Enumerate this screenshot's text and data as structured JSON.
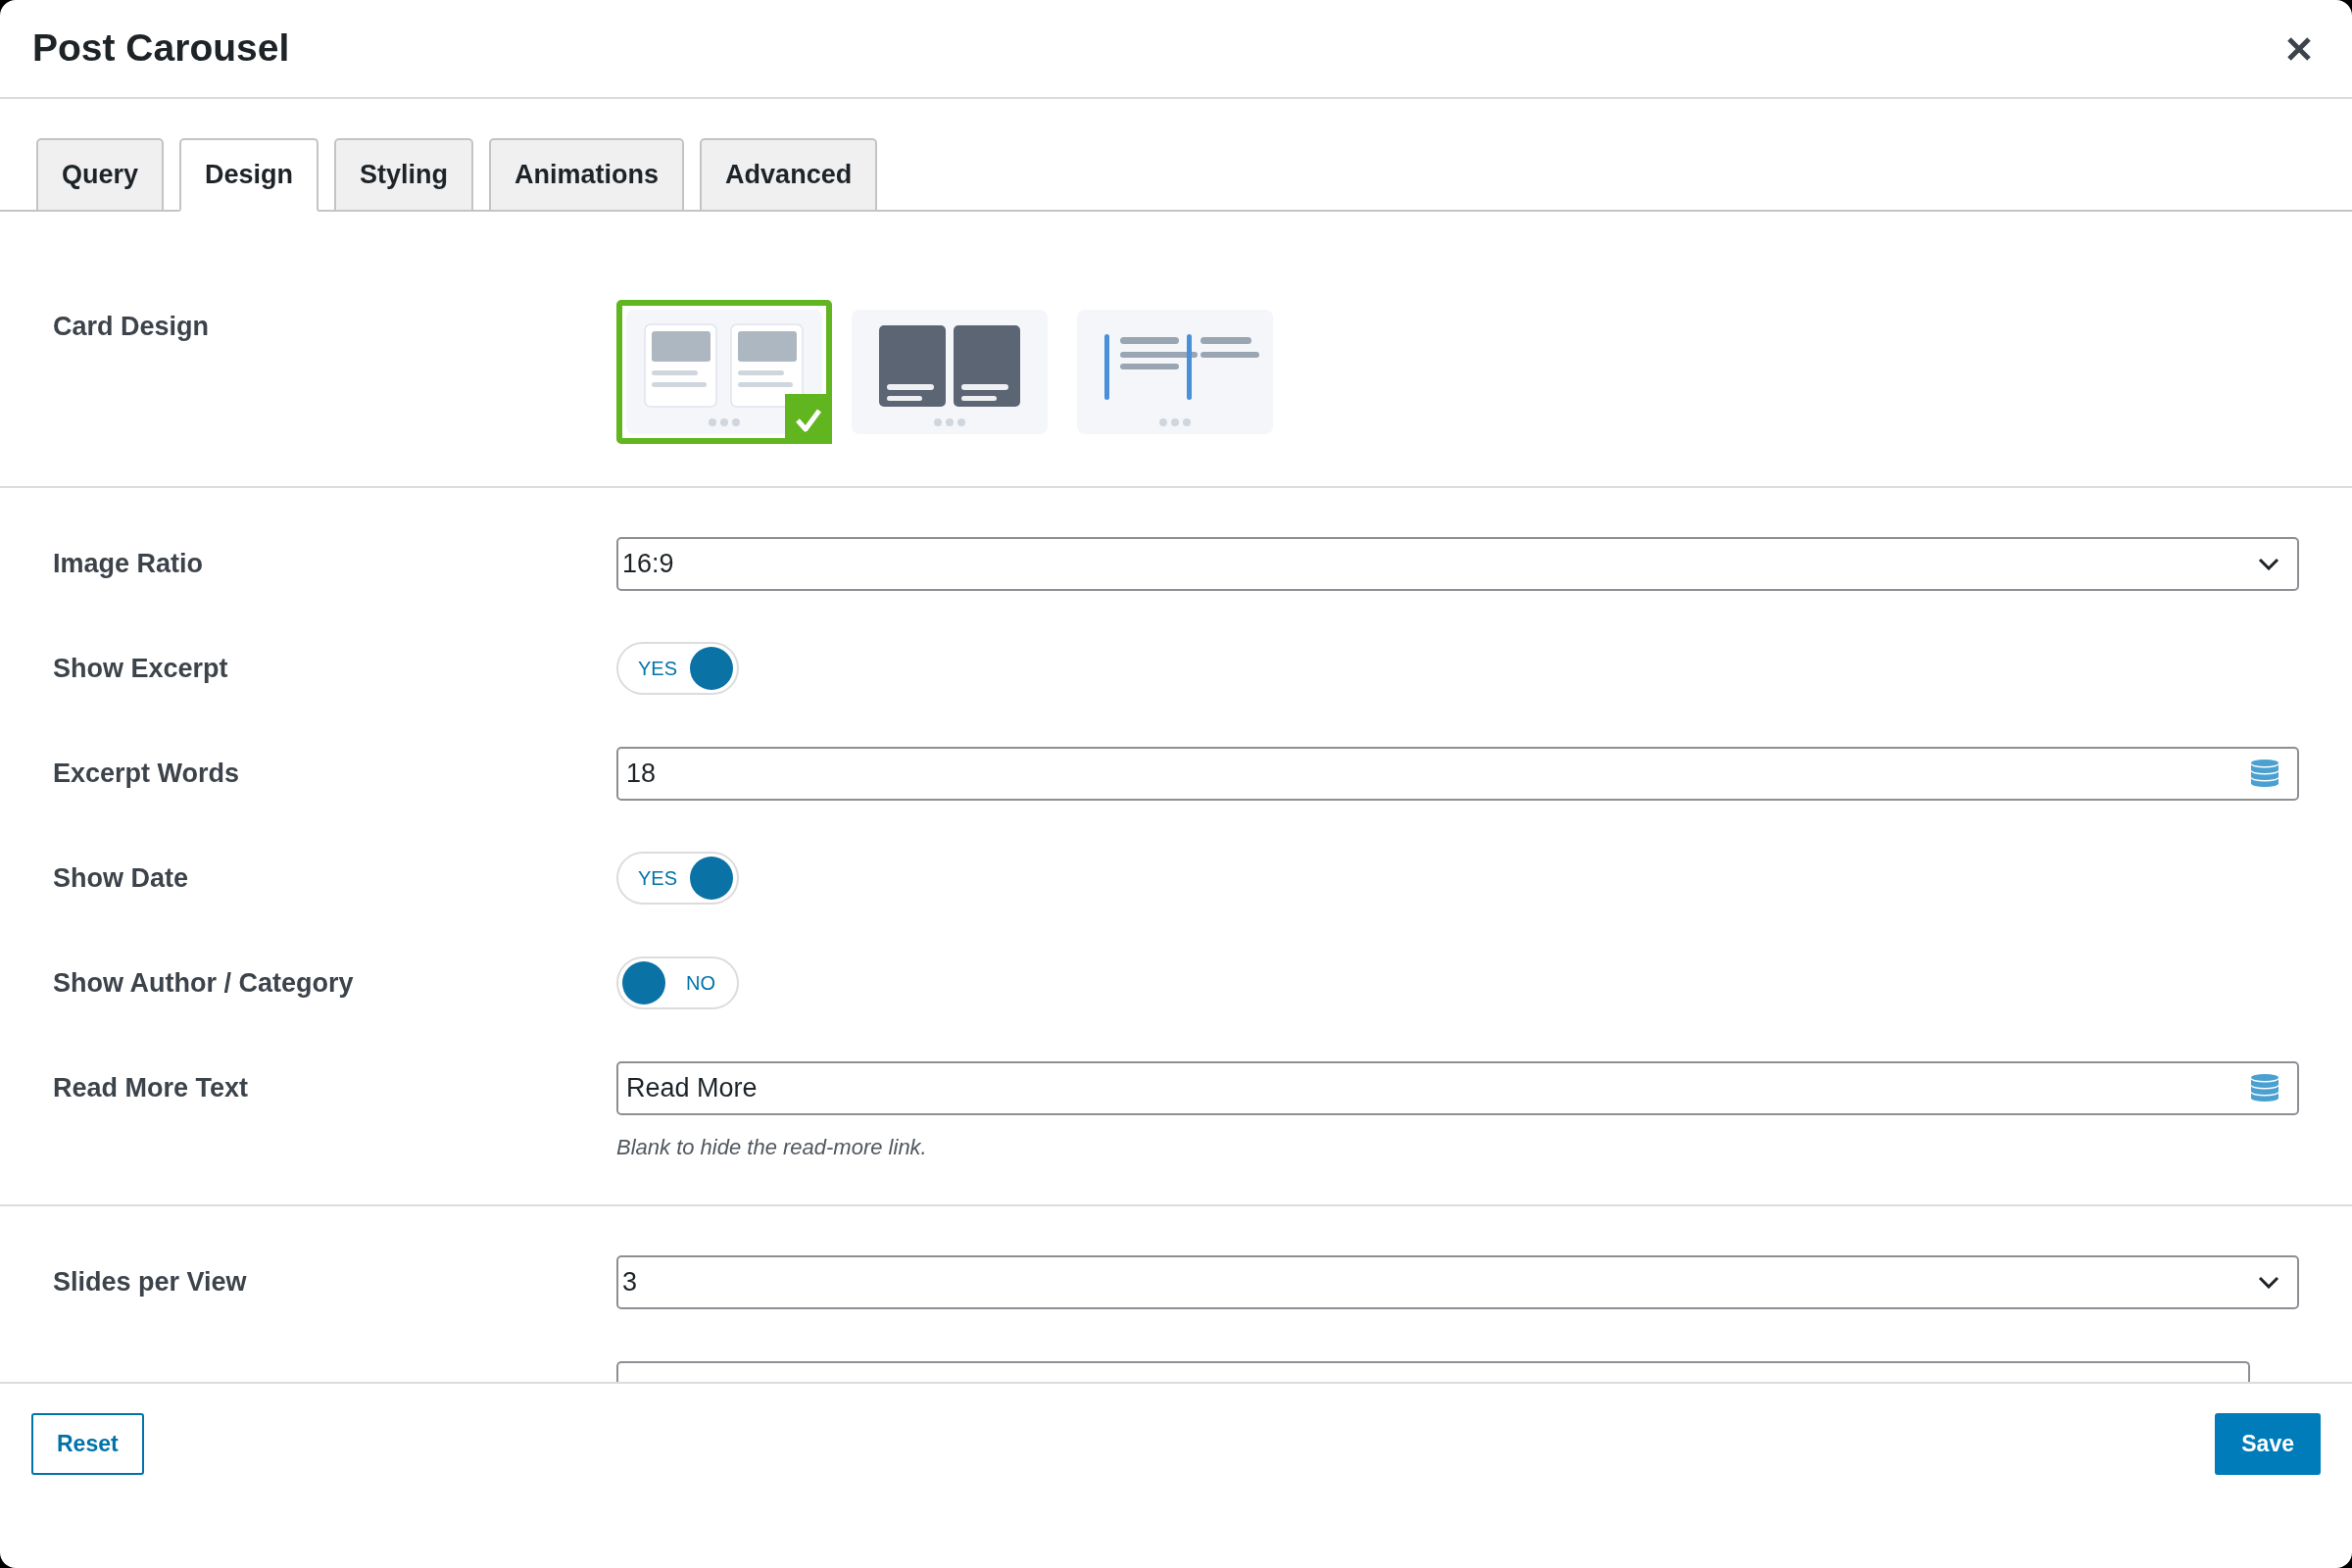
{
  "dialog": {
    "title": "Post Carousel"
  },
  "tabs": [
    {
      "label": "Query",
      "selected": false
    },
    {
      "label": "Design",
      "selected": true
    },
    {
      "label": "Styling",
      "selected": false
    },
    {
      "label": "Animations",
      "selected": false
    },
    {
      "label": "Advanced",
      "selected": false
    }
  ],
  "card_design": {
    "label": "Card Design",
    "options": [
      {
        "kind": "light",
        "selected": true
      },
      {
        "kind": "dark",
        "selected": false
      },
      {
        "kind": "list",
        "selected": false
      }
    ]
  },
  "settings": [
    {
      "kind": "select",
      "label": "Image Ratio",
      "value": "16:9"
    },
    {
      "kind": "toggle",
      "label": "Show Excerpt",
      "on": true,
      "state_label": "YES"
    },
    {
      "kind": "text",
      "label": "Excerpt Words",
      "value": "18"
    },
    {
      "kind": "toggle",
      "label": "Show Date",
      "on": true,
      "state_label": "YES"
    },
    {
      "kind": "toggle",
      "label": "Show Author / Category",
      "on": false,
      "state_label": "NO"
    },
    {
      "kind": "text",
      "label": "Read More Text",
      "value": "Read More",
      "hint": "Blank to hide the read-more link."
    }
  ],
  "carousel_settings": [
    {
      "kind": "select",
      "label": "Slides per View",
      "value": "3",
      "cut_off": false
    },
    {
      "kind": "select",
      "cut_off": true
    }
  ],
  "footer": {
    "buttons": [
      {
        "kind": "outline",
        "label": "Reset"
      },
      {
        "kind": "primary",
        "label": "Save"
      }
    ]
  }
}
